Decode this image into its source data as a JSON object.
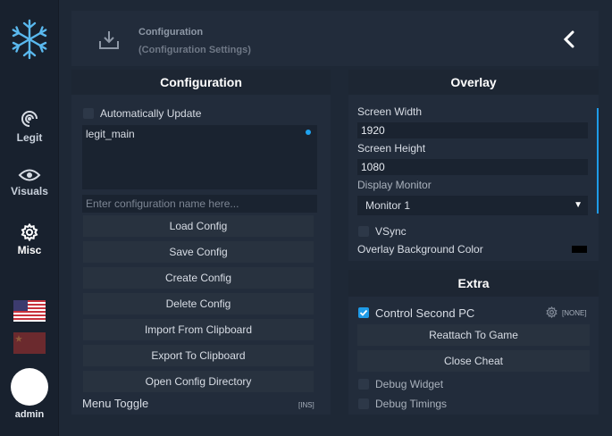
{
  "sidebar": {
    "logo_icon": "snowflake-icon",
    "items": [
      {
        "label": "Legit",
        "icon": "target-rings-icon"
      },
      {
        "label": "Visuals",
        "icon": "eye-icon"
      },
      {
        "label": "Misc",
        "icon": "gear-icon"
      }
    ],
    "flags": [
      "us-flag-icon",
      "cn-flag-icon"
    ],
    "user": "admin"
  },
  "header": {
    "title": "Configuration",
    "subtitle": "(Configuration Settings)",
    "icon": "download-icon",
    "back_icon": "chevron-left-icon"
  },
  "config_panel": {
    "title": "Configuration",
    "auto_update_label": "Automatically Update",
    "configs": [
      "legit_main"
    ],
    "name_placeholder": "Enter configuration name here...",
    "buttons": [
      "Load Config",
      "Save Config",
      "Create Config",
      "Delete Config",
      "Import From Clipboard",
      "Export To Clipboard",
      "Open Config Directory"
    ],
    "menu_toggle_label": "Menu Toggle",
    "menu_toggle_key": "[INS]"
  },
  "overlay_panel": {
    "title": "Overlay",
    "screen_width_label": "Screen Width",
    "screen_width": "1920",
    "screen_height_label": "Screen Height",
    "screen_height": "1080",
    "display_monitor_label": "Display Monitor",
    "display_monitor": "Monitor 1",
    "vsync_label": "VSync",
    "bg_color_label": "Overlay Background Color",
    "bg_color": "#000000"
  },
  "extra_panel": {
    "title": "Extra",
    "control_second_pc_label": "Control Second PC",
    "control_second_pc_key": "[NONE]",
    "reattach_label": "Reattach To Game",
    "close_label": "Close Cheat",
    "debug_widget_label": "Debug Widget",
    "debug_timings_label": "Debug Timings"
  },
  "colors": {
    "accent": "#1e9be8",
    "background": "#1e2836",
    "panel": "#222c3b"
  }
}
